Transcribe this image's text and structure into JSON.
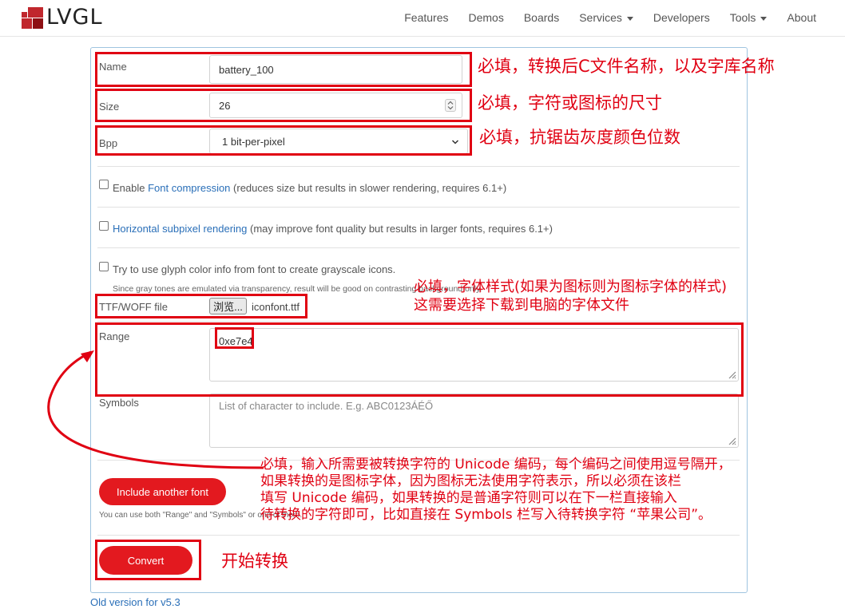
{
  "brand": {
    "logo_text": "LVGL"
  },
  "nav": {
    "items": [
      {
        "label": "Features",
        "dropdown": false
      },
      {
        "label": "Demos",
        "dropdown": false
      },
      {
        "label": "Boards",
        "dropdown": false
      },
      {
        "label": "Services",
        "dropdown": true
      },
      {
        "label": "Developers",
        "dropdown": false
      },
      {
        "label": "Tools",
        "dropdown": true
      },
      {
        "label": "About",
        "dropdown": false
      }
    ]
  },
  "form": {
    "name": {
      "label": "Name",
      "value": "battery_100"
    },
    "size": {
      "label": "Size",
      "value": "26"
    },
    "bpp": {
      "label": "Bpp",
      "value": "1 bit-per-pixel"
    },
    "font_compression": {
      "prefix": "Enable ",
      "link": "Font compression",
      "suffix": " (reduces size but results in slower rendering, requires 6.1+)"
    },
    "subpixel": {
      "link": "Horizontal subpixel rendering",
      "suffix": " (may improve font quality but results in larger fonts, requires 6.1+)"
    },
    "glyph_color": {
      "label": "Try to use glyph color info from font to create grayscale icons.",
      "note": "Since gray tones are emulated via transparency, result will be good on contrasting background only."
    },
    "ttf": {
      "label": "TTF/WOFF file",
      "browse_label": "浏览...",
      "file_name": "iconfont.ttf"
    },
    "range": {
      "label": "Range",
      "value": "0xe7e4"
    },
    "symbols": {
      "label": "Symbols",
      "placeholder": "List of character to include. E.g. ABC0123ÁÉŐ"
    },
    "include_another_font": "Include another font",
    "hint": "You can use both \"Range\" and \"Symbols\" or one of them.",
    "convert": "Convert",
    "old_version": "Old version for v5.3"
  },
  "annotations": {
    "name": "必填，转换后C文件名称，以及字库名称",
    "size": "必填，字符或图标的尺寸",
    "bpp": "必填，抗锯齿灰度颜色位数",
    "ttf_line1": "必填，字体样式(如果为图标则为图标字体的样式)",
    "ttf_line2": "这需要选择下载到电脑的字体文件",
    "range_line1": "必填，输入所需要被转换字符的 Unicode 编码，每个编码之间使用逗号隔开，",
    "range_line2": "如果转换的是图标字体，因为图标无法使用字符表示，所以必须在该栏",
    "range_line3": "填写 Unicode 编码，如果转换的是普通字符则可以在下一栏直接输入",
    "range_line4": "待转换的字符即可，比如直接在 Symbols 栏写入待转换字符 “苹果公司”。",
    "convert": "开始转换"
  },
  "colors": {
    "accent": "#e3191f",
    "link": "#2a6fb8",
    "annotation": "#e00012",
    "panel_border": "#9fc4e0"
  }
}
